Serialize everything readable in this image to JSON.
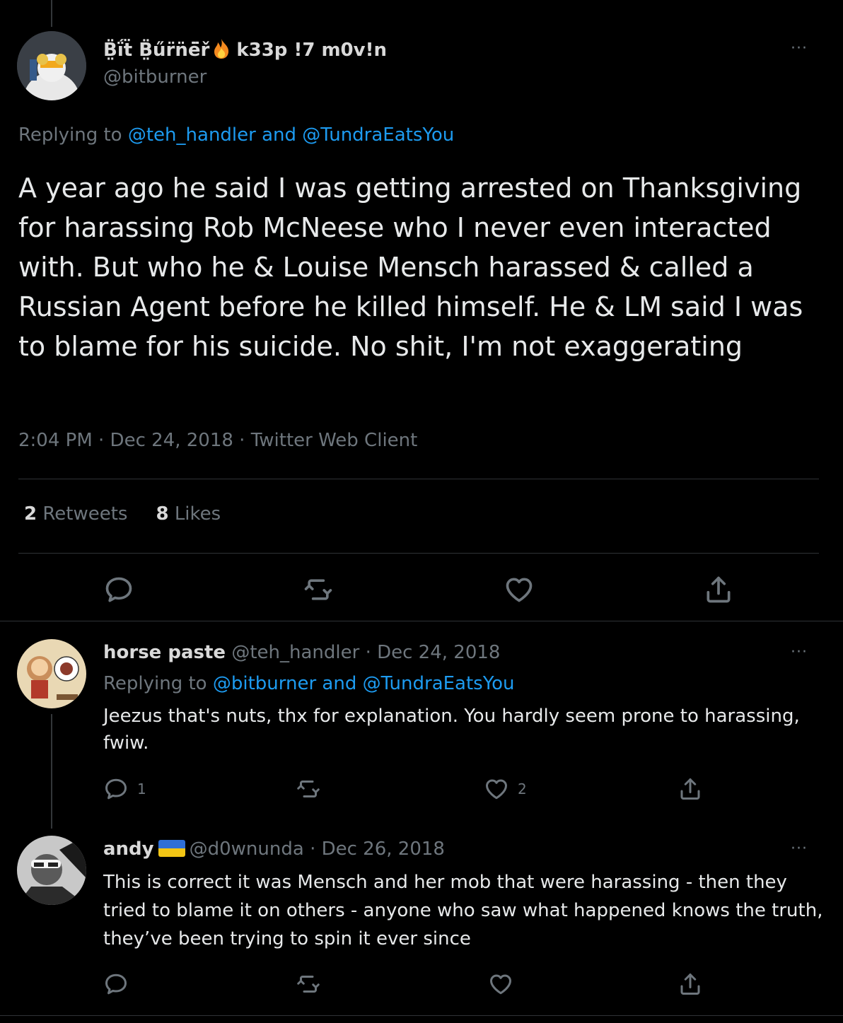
{
  "main_tweet": {
    "display_name": "B̤̈ḯẗ B̤̈űr̈n̈ë̈ř",
    "name_suffix": "k33p !7 m0v!n",
    "handle": "@bitburner",
    "more": "···",
    "replying_prefix": "Replying to",
    "replying_targets": "@teh_handler and @TundraEatsYou",
    "text": "A year ago he said I was getting arrested on Thanksgiving for harassing Rob McNeese who I never even interacted with. But who he & Louise Mensch harassed & called a Russian Agent before he killed himself. He & LM said I was to blame for his suicide. No shit, I'm not exaggerating",
    "meta": "2:04 PM · Dec 24, 2018 · Twitter Web Client",
    "retweets_count": "2",
    "retweets_label": "Retweets",
    "likes_count": "8",
    "likes_label": "Likes",
    "icons": [
      "reply-icon",
      "retweet-icon",
      "like-icon",
      "share-icon"
    ]
  },
  "replies": [
    {
      "display_name": "horse paste",
      "handle": "@teh_handler",
      "date": "· Dec 24, 2018",
      "more": "···",
      "replying_prefix": "Replying to",
      "replying_targets": "@bitburner and @TundraEatsYou",
      "text": "Jeezus that's nuts, thx for explanation. You hardly seem prone to harassing, fwiw.",
      "reply_count": "1",
      "retweet_count": "",
      "like_count": "2"
    },
    {
      "display_name": "andy",
      "flag": "ukraine-flag",
      "handle": "@d0wnunda",
      "date": "· Dec 26, 2018",
      "more": "···",
      "text": "This is correct it was Mensch and her mob that were harassing - then they tried to blame it on others - anyone who saw what happened knows the truth, they’ve been trying to spin it ever since",
      "reply_count": "",
      "retweet_count": "",
      "like_count": ""
    }
  ],
  "colors": {
    "background": "#000000",
    "text": "#d9d9d9",
    "muted": "#6e767d",
    "link": "#1d9bf0",
    "divider": "#2f3336"
  }
}
